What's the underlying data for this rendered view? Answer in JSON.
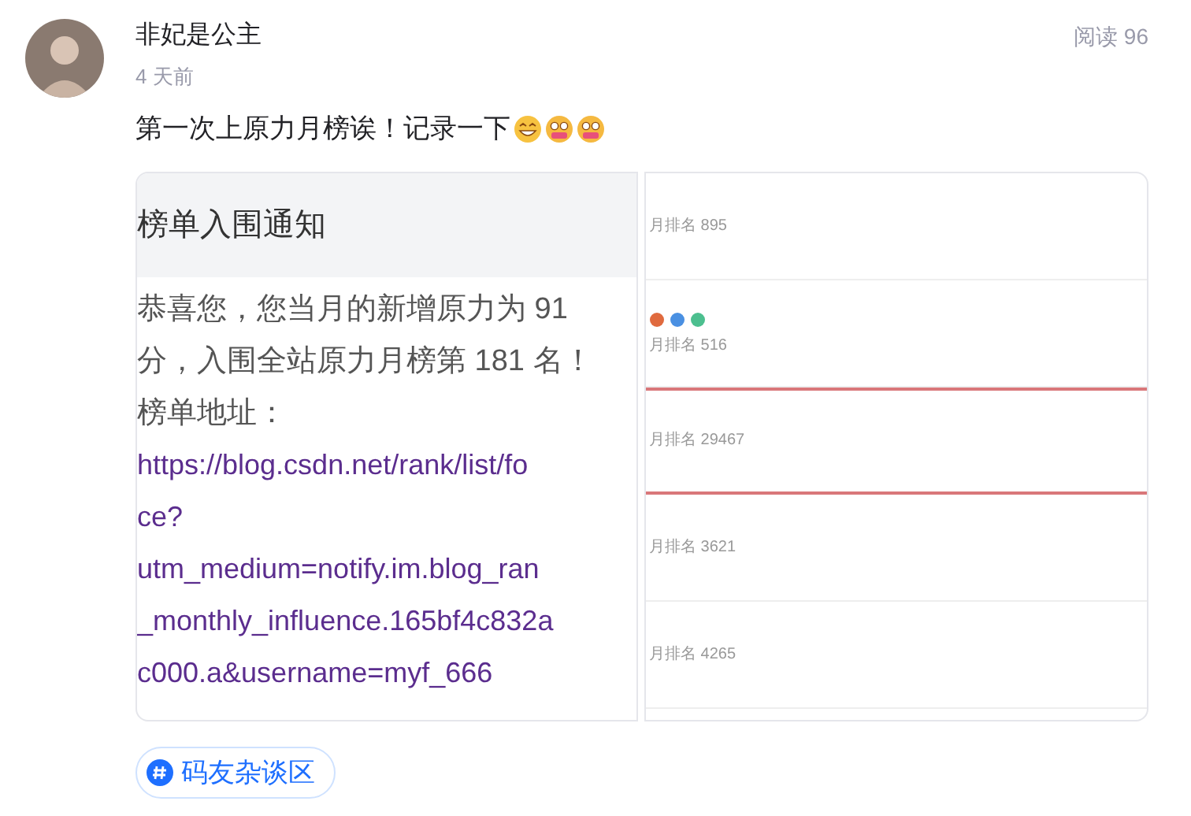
{
  "post": {
    "author": "非妃是公主",
    "time": "4 天前",
    "reads": "阅读 96",
    "text": "第一次上原力月榜诶！记录一下",
    "images": [
      {
        "kind": "notification",
        "title": "榜单入围通知",
        "lines": [
          {
            "text": "恭喜您，您当月的新增原力为 91",
            "link": false
          },
          {
            "text": "分，入围全站原力月榜第 181 名！",
            "link": false
          },
          {
            "text": "榜单地址：",
            "link": false
          },
          {
            "text": "https://blog.csdn.net/rank/list/fo",
            "link": true
          },
          {
            "text": "ce?",
            "link": true
          },
          {
            "text": "utm_medium=notify.im.blog_ran",
            "link": true
          },
          {
            "text": "_monthly_influence.165bf4c832a",
            "link": true
          },
          {
            "text": "c000.a&username=myf_666",
            "link": true
          }
        ]
      },
      {
        "kind": "ranking",
        "rows": [
          {
            "text": "月排名 895",
            "highlighted": false,
            "badges": false
          },
          {
            "text": "月排名 516",
            "highlighted": false,
            "badges": true
          },
          {
            "text": "月排名 29467",
            "highlighted": true,
            "badges": false
          },
          {
            "text": "月排名 3621",
            "highlighted": false,
            "badges": false
          },
          {
            "text": "月排名 4265",
            "highlighted": false,
            "badges": false
          }
        ]
      }
    ],
    "tag": "码友杂谈区"
  }
}
